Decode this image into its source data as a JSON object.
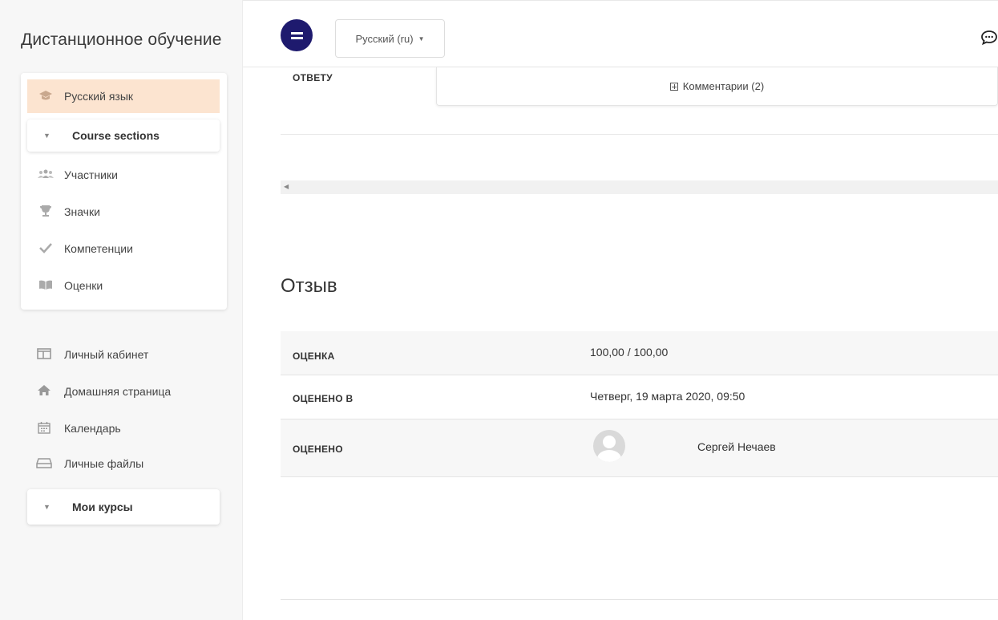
{
  "sidebar": {
    "brand": "Дистанционное обучение",
    "course": {
      "active_item": {
        "label": "Русский язык",
        "icon": "graduation-cap-icon"
      },
      "sections_label": "Course sections",
      "items": [
        {
          "label": "Участники",
          "icon": "users-icon"
        },
        {
          "label": "Значки",
          "icon": "trophy-icon"
        },
        {
          "label": "Компетенции",
          "icon": "checkmark-icon"
        },
        {
          "label": "Оценки",
          "icon": "book-icon"
        }
      ]
    },
    "nav": [
      {
        "label": "Личный кабинет",
        "icon": "dashboard-icon"
      },
      {
        "label": "Домашняя страница",
        "icon": "home-icon"
      },
      {
        "label": "Календарь",
        "icon": "calendar-icon"
      },
      {
        "label": "Личные файлы",
        "icon": "drive-icon"
      }
    ],
    "my_courses_label": "Мои курсы"
  },
  "topbar": {
    "language": "Русский (ru)",
    "accent_color": "#1e1a6e"
  },
  "main": {
    "response_label": "ОТВЕТУ",
    "comments_label": "Комментарии (2)",
    "feedback": {
      "title": "Отзыв",
      "rows": [
        {
          "label": "ОЦЕНКА",
          "value": "100,00 / 100,00"
        },
        {
          "label": "ОЦЕНЕНО В",
          "value": "Четверг, 19 марта 2020, 09:50"
        },
        {
          "label": "ОЦЕНЕНО",
          "value": "Сергей Нечаев"
        }
      ]
    }
  }
}
